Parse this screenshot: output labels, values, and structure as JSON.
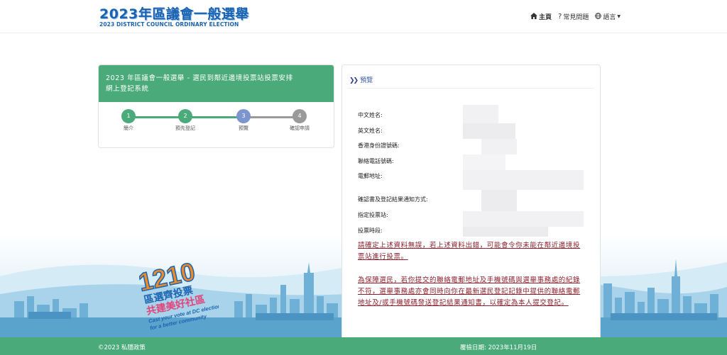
{
  "header": {
    "logo_title": "2023年區議會一般選舉",
    "logo_subtitle": "2023 DISTRICT COUNCIL ORDINARY ELECTION",
    "nav": {
      "home": "主頁",
      "faq": "常見問題",
      "language": "語言"
    }
  },
  "left_panel": {
    "title_line1": "2023 年區議會一般選舉 - 選民到鄰近邊境投票站投票安排",
    "title_line2": "網上登記系統",
    "steps": [
      {
        "number": "1",
        "label": "簡介",
        "status": "done"
      },
      {
        "number": "2",
        "label": "預先登記",
        "status": "done"
      },
      {
        "number": "3",
        "label": "預覽",
        "status": "current"
      },
      {
        "number": "4",
        "label": "確認申請",
        "status": "pending"
      }
    ]
  },
  "right_panel": {
    "heading": "預覽",
    "fields": [
      "中文姓名:",
      "英文姓名:",
      "香港身份證號碼:",
      "聯絡電話號碼:",
      "電郵地址:",
      "確認書及登記結果通知方式:",
      "指定投票站:",
      "投票時段:"
    ],
    "warning_1": "請確定上述資料無誤，若上述資料出錯，可能會令你未能在鄰近邊境投票站進行投票。",
    "warning_2": "為保障選民，若你提交的聯絡電郵地址及手機號碼與選舉事務處的紀錄不符，選舉事務處亦會同時向你在最新選民登記記錄中提供的聯絡電郵地址及/或手機號碼發送登記結果通知書，以確定為本人提交登記。"
  },
  "badge": {
    "number": "1210",
    "line1": "區選齊投票",
    "line2": "共建美好社區",
    "line3": "Cast your vote at DC election",
    "line4": "for a better community"
  },
  "footer": {
    "copyright": "©2023",
    "privacy": "私隱政策",
    "review_date": "覆檢日期: 2023年11月19日"
  },
  "colors": {
    "primary_green": "#4aaa7a",
    "current_step_blue": "#7b95cf",
    "pending_grey": "#9a9a9a",
    "warning_red": "#8b1f2c",
    "logo_blue": "#1a63b0"
  }
}
